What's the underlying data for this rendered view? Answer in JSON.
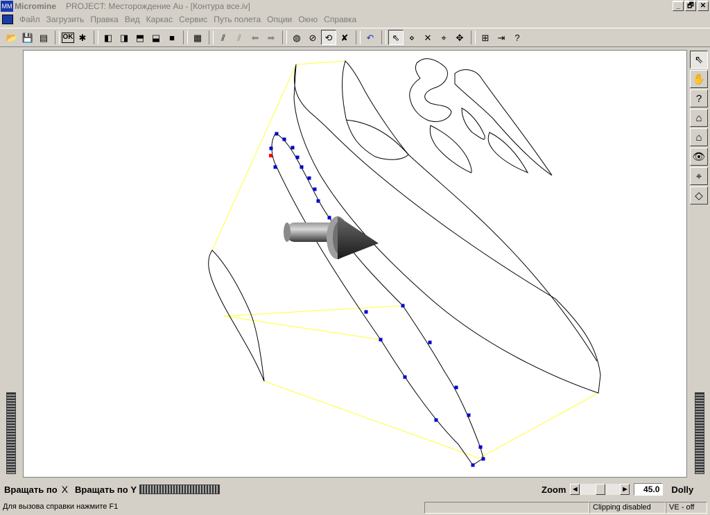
{
  "window": {
    "app_name": "Micromine",
    "title": "PROJECT: Месторождение Au - [Контура все.iv]",
    "btn_min": "_",
    "btn_restore": "🗗",
    "btn_close": "✕"
  },
  "menu": {
    "items": [
      "Файл",
      "Загрузить",
      "Правка",
      "Вид",
      "Каркас",
      "Сервис",
      "Путь полета",
      "Опции",
      "Окно",
      "Справка"
    ]
  },
  "toolbar": {
    "ok_label": "OK"
  },
  "bottom": {
    "rotate_x_label": "Вращать по",
    "rotate_x_axis": "X",
    "rotate_y_label": "Вращать по Y",
    "zoom_label": "Zoom",
    "zoom_value": "45.0",
    "dolly_label": "Dolly"
  },
  "status": {
    "help_text": "Для вызова справки нажмите F1",
    "clipping": "Clipping disabled",
    "ve": "VE - off"
  },
  "colors": {
    "outline": "#000000",
    "section": "#ffff33",
    "points": "#0000cc",
    "selected_point": "#ff0000"
  }
}
